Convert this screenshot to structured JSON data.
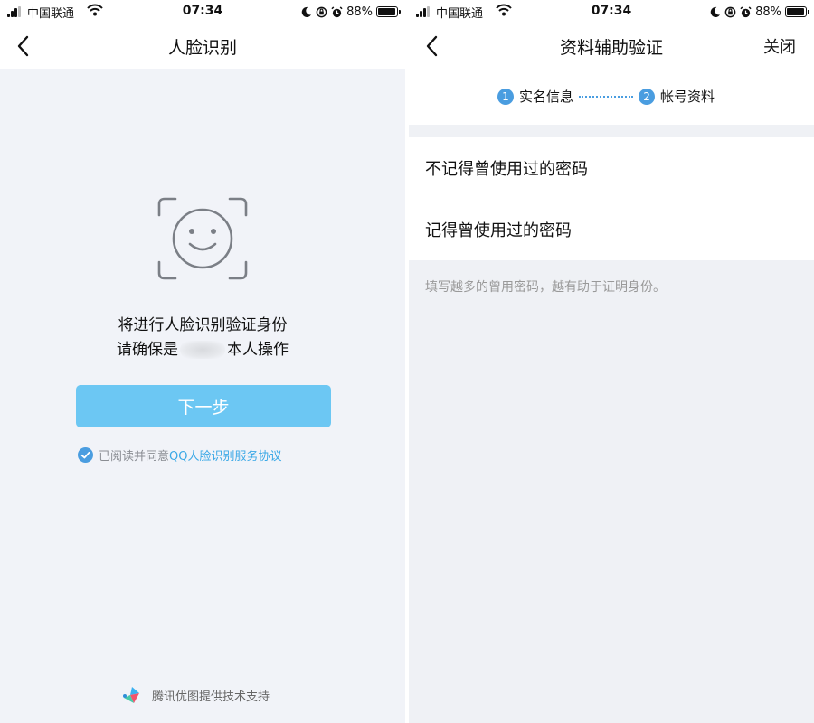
{
  "left": {
    "status_bar": {
      "carrier": "中国联通",
      "time": "07:34",
      "battery": "88%"
    },
    "nav": {
      "title": "人脸识别"
    },
    "intro": {
      "line1": "将进行人脸识别验证身份",
      "line2_prefix": "请确保是",
      "line2_suffix": "本人操作"
    },
    "next_button": "下一步",
    "agreement": {
      "text": "已阅读并同意",
      "link": "QQ人脸识别服务协议"
    },
    "powered_by": "腾讯优图提供技术支持"
  },
  "right": {
    "status_bar": {
      "carrier": "中国联通",
      "time": "07:34",
      "battery": "88%"
    },
    "nav": {
      "title": "资料辅助验证",
      "close": "关闭"
    },
    "steps": [
      {
        "num": "1",
        "label": "实名信息"
      },
      {
        "num": "2",
        "label": "帐号资料"
      }
    ],
    "options": [
      {
        "label": "不记得曾使用过的密码"
      },
      {
        "label": "记得曾使用过的密码"
      }
    ],
    "hint": "填写越多的曾用密码，越有助于证明身份。"
  },
  "battery_level": 0.88,
  "colors": {
    "accent": "#6cc7f3",
    "link": "#3aa8e6",
    "step": "#4a9de0"
  },
  "icons": [
    "back-icon",
    "face-scan-icon",
    "check-icon",
    "youtu-logo-icon",
    "moon-icon",
    "lock-rotation-icon",
    "alarm-icon",
    "wifi-icon",
    "signal-icon",
    "battery-icon"
  ]
}
